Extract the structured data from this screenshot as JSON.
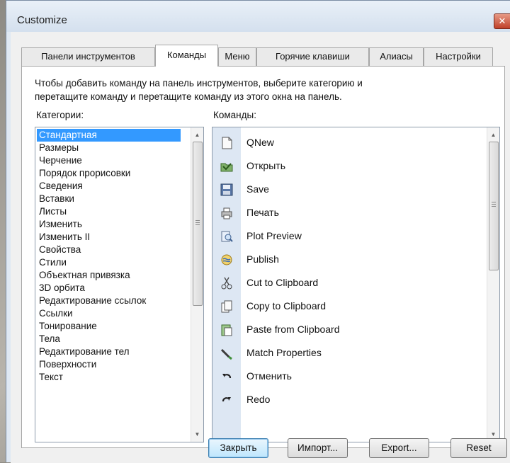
{
  "window": {
    "title": "Customize",
    "close_glyph": "✕"
  },
  "tabs": [
    {
      "label": "Панели инструментов",
      "active": false
    },
    {
      "label": "Команды",
      "active": true
    },
    {
      "label": "Меню",
      "active": false
    },
    {
      "label": "Горячие клавиши",
      "active": false
    },
    {
      "label": "Алиасы",
      "active": false
    },
    {
      "label": "Настройки",
      "active": false
    }
  ],
  "instruction": {
    "line1": "Чтобы добавить команду на панель инструментов, выберите категорию и",
    "line2": "перетащите команду и перетащите команду из этого окна на панель."
  },
  "categories": {
    "label": "Категории:",
    "selected": "Стандартная",
    "items": [
      "Стандартная",
      "Размеры",
      "Черчение",
      "Порядок прорисовки",
      "Сведения",
      "Вставки",
      "Листы",
      "Изменить",
      "Изменить II",
      "Свойства",
      "Стили",
      "Объектная привязка",
      "3D орбита",
      "Редактирование ссылок",
      "Ссылки",
      "Тонирование",
      "Тела",
      "Редактирование тел",
      "Поверхности",
      "Текст"
    ]
  },
  "commands": {
    "label": "Команды:",
    "items": [
      {
        "label": "QNew",
        "icon": "new-document-icon"
      },
      {
        "label": "Открыть",
        "icon": "open-folder-icon"
      },
      {
        "label": "Save",
        "icon": "floppy-disk-icon"
      },
      {
        "label": "Печать",
        "icon": "printer-icon"
      },
      {
        "label": "Plot Preview",
        "icon": "plot-preview-icon"
      },
      {
        "label": "Publish",
        "icon": "publish-icon"
      },
      {
        "label": "Cut to Clipboard",
        "icon": "scissors-icon"
      },
      {
        "label": "Copy to Clipboard",
        "icon": "copy-icon"
      },
      {
        "label": "Paste from Clipboard",
        "icon": "paste-icon"
      },
      {
        "label": "Match Properties",
        "icon": "brush-icon"
      },
      {
        "label": "Отменить",
        "icon": "undo-icon"
      },
      {
        "label": "Redo",
        "icon": "redo-icon"
      }
    ]
  },
  "buttons": {
    "close": "Закрыть",
    "import": "Импорт...",
    "export": "Export...",
    "reset": "Reset"
  },
  "colors": {
    "selection": "#3399ff",
    "accent_close": "#c0412a"
  }
}
